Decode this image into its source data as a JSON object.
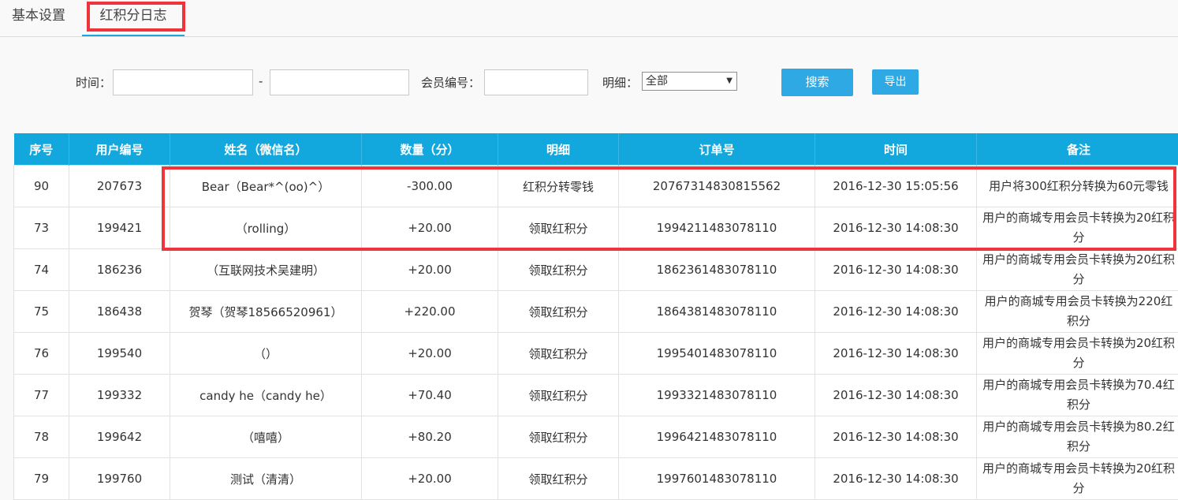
{
  "tabs": [
    {
      "label": "基本设置"
    },
    {
      "label": "红积分日志"
    }
  ],
  "filters": {
    "time_label": "时间：",
    "range_sep": "-",
    "time_start": "",
    "time_end": "",
    "member_label": "会员编号：",
    "member_value": "",
    "detail_label": "明细：",
    "detail_selected": "全部",
    "search_button": "搜索",
    "export_button": "导出"
  },
  "table": {
    "headers": [
      "序号",
      "用户编号",
      "姓名（微信名）",
      "数量（分）",
      "明细",
      "订单号",
      "时间",
      "备注"
    ],
    "rows": [
      [
        "90",
        "207673",
        "Bear（Bear*^(oo)^）",
        "-300.00",
        "红积分转零钱",
        "20767314830815562",
        "2016-12-30 15:05:56",
        "用户将300红积分转换为60元零钱"
      ],
      [
        "73",
        "199421",
        "（rolling）",
        "+20.00",
        "领取红积分",
        "1994211483078110",
        "2016-12-30 14:08:30",
        "用户的商城专用会员卡转换为20红积分"
      ],
      [
        "74",
        "186236",
        "（互联网技术吴建明）",
        "+20.00",
        "领取红积分",
        "1862361483078110",
        "2016-12-30 14:08:30",
        "用户的商城专用会员卡转换为20红积分"
      ],
      [
        "75",
        "186438",
        "贺琴（贺琴18566520961）",
        "+220.00",
        "领取红积分",
        "1864381483078110",
        "2016-12-30 14:08:30",
        "用户的商城专用会员卡转换为220红积分"
      ],
      [
        "76",
        "199540",
        "（）",
        "+20.00",
        "领取红积分",
        "1995401483078110",
        "2016-12-30 14:08:30",
        "用户的商城专用会员卡转换为20红积分"
      ],
      [
        "77",
        "199332",
        "candy he（candy he）",
        "+70.40",
        "领取红积分",
        "1993321483078110",
        "2016-12-30 14:08:30",
        "用户的商城专用会员卡转换为70.4红积分"
      ],
      [
        "78",
        "199642",
        "（嘻嘻）",
        "+80.20",
        "领取红积分",
        "1996421483078110",
        "2016-12-30 14:08:30",
        "用户的商城专用会员卡转换为80.2红积分"
      ],
      [
        "79",
        "199760",
        "测试（清清）",
        "+20.00",
        "领取红积分",
        "1997601483078110",
        "2016-12-30 14:08:30",
        "用户的商城专用会员卡转换为20红积分"
      ]
    ]
  }
}
